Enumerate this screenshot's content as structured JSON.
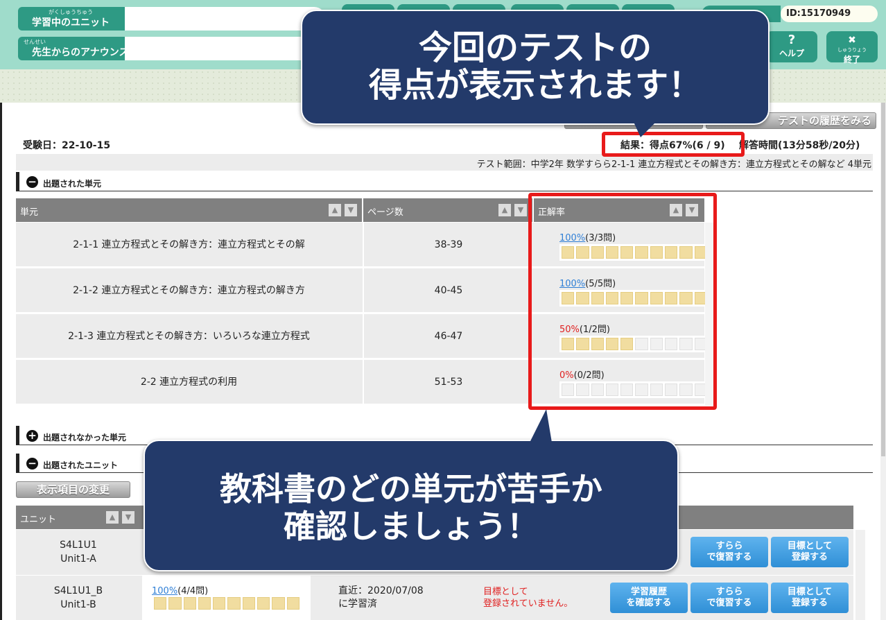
{
  "header": {
    "studying_unit_ruby": "がくしゅうちゅう",
    "studying_unit_label": "学習中のユニット",
    "announce_ruby": "せんせい",
    "announce_label": "先生からのアナウンス",
    "user_id": "ID:15170949",
    "help_icon": "?",
    "help_label": "ヘルプ",
    "exit_ruby": "しゅうりょう",
    "exit_label": "終了"
  },
  "toolbar": {
    "history_button": "テストの履歴をみる"
  },
  "result": {
    "exam_date": "受験日：22-10-15",
    "score": "結果：得点67%(6 / 9)",
    "answer_time": "解答時間(13分58秒/20分)",
    "range": "テスト範囲：中学2年 数学すらら2-1-1 連立方程式とその解き方：連立方程式とその解など 4単元"
  },
  "sections": {
    "asked_units": "出題された単元",
    "not_asked_units": "出題されなかった単元",
    "asked_unit_sets": "出題されたユニット"
  },
  "unit_table": {
    "headers": [
      "単元",
      "ページ数",
      "正解率"
    ],
    "rows": [
      {
        "unit": "2-1-1 連立方程式とその解き方：連立方程式とその解",
        "pages": "38-39",
        "pct": "100%",
        "count": "(3/3問)",
        "fraction": 1.0
      },
      {
        "unit": "2-1-2 連立方程式とその解き方：連立方程式の解き方",
        "pages": "40-45",
        "pct": "100%",
        "count": "(5/5問)",
        "fraction": 1.0
      },
      {
        "unit": "2-1-3 連立方程式とその解き方：いろいろな連立方程式",
        "pages": "46-47",
        "pct": "50%",
        "count": "(1/2問)",
        "fraction": 0.5
      },
      {
        "unit": "2-2 連立方程式の利用",
        "pages": "51-53",
        "pct": "0%",
        "count": "(0/2問)",
        "fraction": 0.0
      }
    ]
  },
  "display_change_button": "表示項目の変更",
  "lower_table": {
    "header_unit": "ユニット",
    "rows": [
      {
        "code": "S4L1U1",
        "name": "Unit1-A",
        "review_btn": "すらら\nで復習する",
        "goal_btn": "目標として\n登録する"
      },
      {
        "code": "S4L1U1_B",
        "name": "Unit1-B",
        "pct": "100%",
        "count": "(4/4問)",
        "fraction": 1.0,
        "recent": "直近：2020/07/08\nに学習済",
        "goal_status": "目標として\n登録されていません。",
        "history_btn": "学習履歴\nを確認する",
        "review_btn": "すらら\nで復習する",
        "goal_btn": "目標として\n登録する"
      }
    ]
  },
  "callouts": {
    "top": "今回のテストの\n得点が表示されます！",
    "bottom": "教科書のどの単元が苦手か\n確認しましょう！"
  },
  "colors": {
    "header_bg": "#9fdccb",
    "header_button": "#2e9a84",
    "callout_bg": "#233a6a",
    "highlight_red": "#e81a1a",
    "bar_fill": "#f1dda0",
    "link_blue": "#2f7fd6",
    "low_red": "#e02020"
  }
}
